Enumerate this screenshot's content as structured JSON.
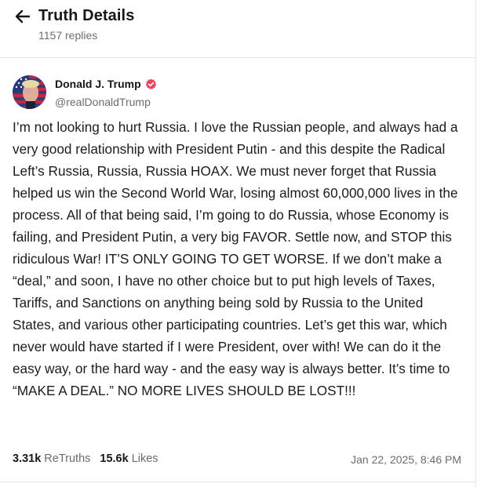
{
  "header": {
    "title": "Truth Details",
    "replies": "1157 replies",
    "back_icon": "arrow-left-icon"
  },
  "author": {
    "name": "Donald J. Trump",
    "handle": "@realDonaldTrump",
    "verified_icon": "verified-badge-icon",
    "verified_color": "#e8475f"
  },
  "post": {
    "text": "I’m not looking to hurt Russia. I love the Russian people, and always had a very good relationship with President Putin - and this despite the Radical Left’s Russia, Russia, Russia HOAX. We must never forget that Russia helped us win the Second World War, losing almost 60,000,000 lives in the process. All of that being said, I’m going to do Russia, whose Economy is failing, and President Putin, a very big FAVOR. Settle now, and STOP this ridiculous War! IT’S ONLY GOING TO GET WORSE. If we don’t make a “deal,” and soon, I have no other choice but to put high levels of Taxes, Tariffs, and Sanctions on anything being sold by Russia to the United States, and various other participating countries. Let’s get this war, which never would have started if I were President, over with! We can do it the easy way, or the hard way - and the easy way is always better. It’s time to “MAKE A DEAL.” NO MORE LIVES SHOULD BE LOST!!!",
    "retruths_count": "3.31k",
    "retruths_label": "ReTruths",
    "likes_count": "15.6k",
    "likes_label": "Likes",
    "timestamp": "Jan 22, 2025, 8:46 PM"
  }
}
